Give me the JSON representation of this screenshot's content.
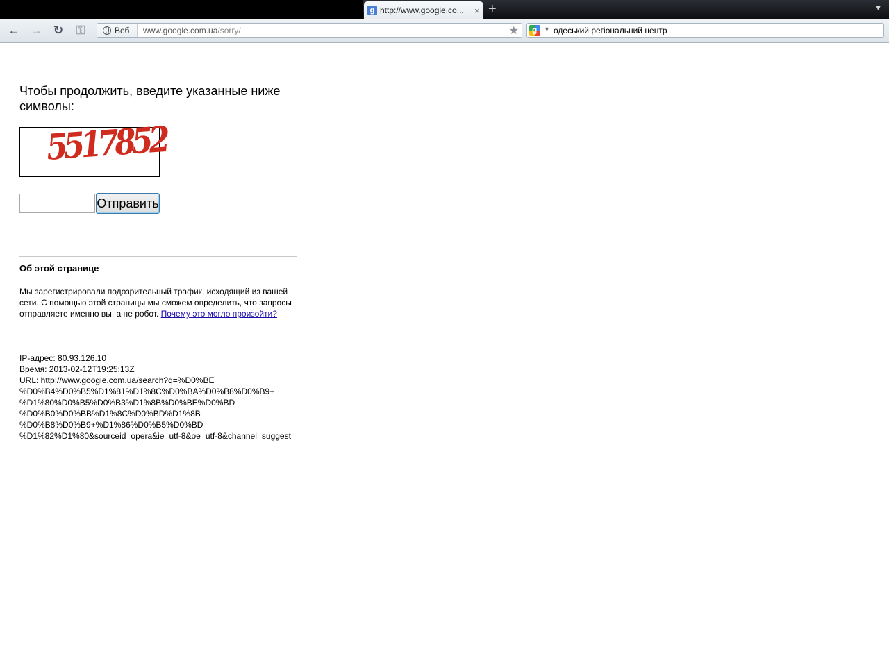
{
  "browser": {
    "tab": {
      "favicon": "g",
      "title": "http://www.google.co...",
      "close": "×"
    },
    "new_tab": "+",
    "tab_menu": "▼",
    "nav": {
      "back_icon": "←",
      "forward_icon": "→",
      "reload_icon": "↻",
      "key_icon": "⚿"
    },
    "address": {
      "chip_label": "Веб",
      "host": "www.google.com.ua",
      "path": "/sorry/",
      "star": "★"
    },
    "search": {
      "engine": "g",
      "dropdown": "▼",
      "value": "одеський регіональний центр"
    }
  },
  "page": {
    "prompt": "Чтобы продолжить, введите указанные ниже символы:",
    "captcha_text": "5517852",
    "submit_label": "Отправить",
    "input_value": "",
    "about_title": "Об этой странице",
    "about_text": "Мы зарегистрировали подозрительный трафик, исходящий из вашей сети. С помощью этой страницы мы сможем определить, что запросы отправляете именно вы, а не робот. ",
    "about_link": "Почему это могло произойти?",
    "meta": {
      "ip": "IP-адрес: 80.93.126.10",
      "time": "Время: 2013-02-12T19:25:13Z",
      "url_lines": [
        "URL: http://www.google.com.ua/search?q=%D0%BE",
        "%D0%B4%D0%B5%D1%81%D1%8C%D0%BA%D0%B8%D0%B9+",
        "%D1%80%D0%B5%D0%B3%D1%8B%D0%BE%D0%BD",
        "%D0%B0%D0%BB%D1%8C%D0%BD%D1%8B",
        "%D0%B8%D0%B9+%D1%86%D0%B5%D0%BD",
        "%D1%82%D1%80&sourceid=opera&ie=utf-8&oe=utf-8&channel=suggest"
      ]
    }
  },
  "colors": {
    "captcha_red": "#cf2b1e",
    "link": "#1a0dab",
    "rule": "#c9c9c9"
  }
}
